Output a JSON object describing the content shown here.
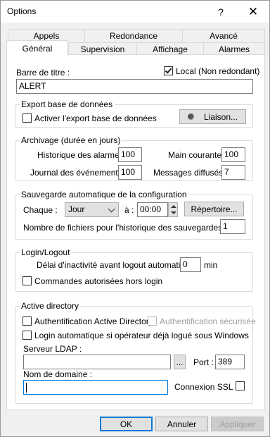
{
  "window": {
    "title": "Options",
    "help_glyph": "?",
    "close_glyph": "✕"
  },
  "tabs": {
    "row1": [
      "Appels",
      "Redondance",
      "Avancé"
    ],
    "row2": [
      "Général",
      "Supervision",
      "Affichage",
      "Alarmes"
    ],
    "active": "Général"
  },
  "general": {
    "title_bar_label": "Barre de titre :",
    "local_label": "Local (Non redondant)",
    "local_checked": true,
    "title_value": "ALERT"
  },
  "db_export": {
    "group_title": "Export base de données",
    "enable_label": "Activer l'export base de données",
    "enable_checked": false,
    "link_button": "Liaison..."
  },
  "archiving": {
    "group_title": "Archivage (durée en jours)",
    "alarm_history_label": "Historique des alarmes",
    "alarm_history_value": "100",
    "main_courante_label": "Main courante",
    "main_courante_value": "100",
    "event_log_label": "Journal des événements",
    "event_log_value": "100",
    "broadcast_label": "Messages diffusés",
    "broadcast_value": "7"
  },
  "autosave": {
    "group_title": "Sauvegarde automatique de la configuration",
    "each_label": "Chaque :",
    "frequency_value": "Jour",
    "at_label": "à :",
    "time_value": "00:00",
    "dir_button": "Répertoire...",
    "history_count_label": "Nombre de fichiers pour l'historique des sauvegardes :",
    "history_count_value": "1"
  },
  "login": {
    "group_title": "Login/Logout",
    "idle_label": "Délai d'inactivité avant logout automatique :",
    "idle_value": "0",
    "idle_unit": "min",
    "offline_commands_label": "Commandes autorisées hors login",
    "offline_commands_checked": false
  },
  "ad": {
    "group_title": "Active directory",
    "ad_auth_label": "Authentification Active Directory",
    "ad_auth_checked": false,
    "secure_auth_label": "Authentification sécurisée",
    "auto_login_label": "Login automatique si opérateur déjà logué sous Windows",
    "ldap_label": "Serveur LDAP :",
    "ldap_value": "",
    "browse_label": "...",
    "port_label": "Port :",
    "port_value": "389",
    "domain_label": "Nom de domaine :",
    "domain_value": "",
    "ssl_label": "Connexion SSL"
  },
  "footer": {
    "ok": "OK",
    "cancel": "Annuler",
    "apply": "Appliquer"
  },
  "colors": {
    "focus": "#0078d7",
    "panel": "#ffffff",
    "chrome": "#f0f0f0"
  }
}
